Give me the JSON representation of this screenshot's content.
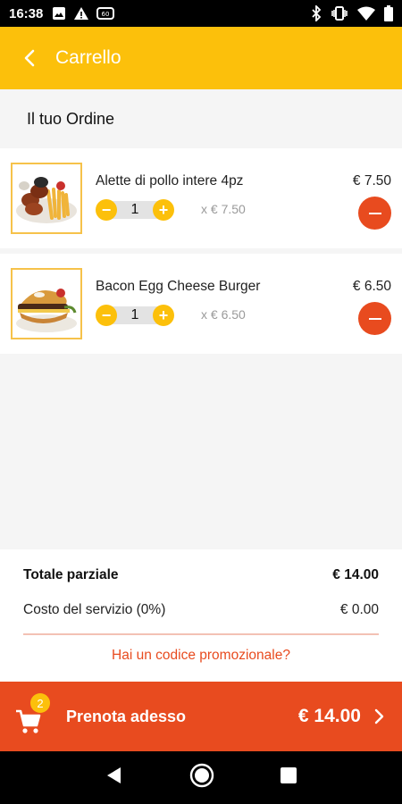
{
  "status_bar": {
    "time": "16:38",
    "left_icons": [
      "image-icon",
      "warning-icon",
      "sync-icon"
    ],
    "right_icons": [
      "bluetooth-icon",
      "vibrate-icon",
      "wifi-icon",
      "battery-icon"
    ]
  },
  "app_bar": {
    "back_icon": "chevron-left-icon",
    "title": "Carrello"
  },
  "section": {
    "title": "Il tuo Ordine"
  },
  "items": [
    {
      "name": "Alette di pollo intere 4pz",
      "price": "€ 7.50",
      "quantity": "1",
      "unit_price": "x  € 7.50",
      "image": "chicken-wings-fries-photo"
    },
    {
      "name": "Bacon Egg Cheese Burger",
      "price": "€ 6.50",
      "quantity": "1",
      "unit_price": "x  € 6.50",
      "image": "burger-photo"
    }
  ],
  "summary": {
    "subtotal_label": "Totale parziale",
    "subtotal_value": "€ 14.00",
    "service_label": "Costo del servizio  (0%)",
    "service_value": "€ 0.00",
    "promo_link": "Hai un codice promozionale?"
  },
  "checkout": {
    "cart_icon": "cart-icon",
    "badge_count": "2",
    "cta_label": "Prenota adesso",
    "total": "€ 14.00"
  },
  "nav": {
    "back": "nav-back-icon",
    "home": "nav-home-icon",
    "recents": "nav-recents-icon"
  },
  "colors": {
    "primary_yellow": "#fcc00b",
    "accent_orange": "#e84b1f"
  }
}
